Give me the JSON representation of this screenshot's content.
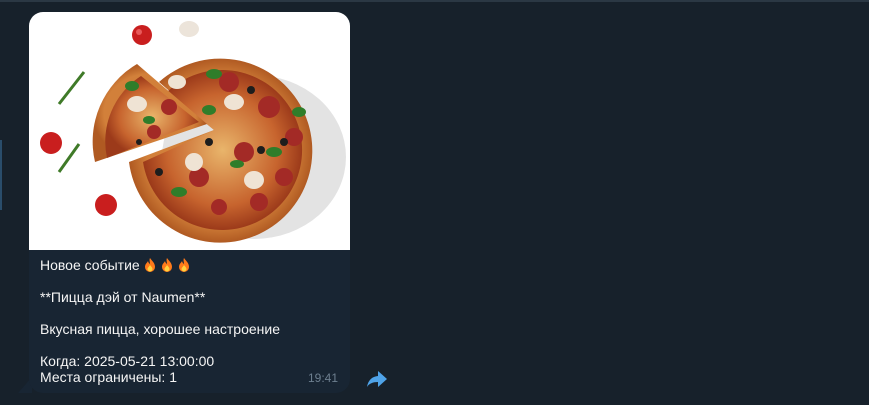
{
  "message": {
    "title": "Новое событие",
    "emoji": [
      "fire-icon",
      "fire-icon",
      "fire-icon"
    ],
    "event_name": "**Пицца дэй от Naumen**",
    "description": "Вкусная пицца, хорошее настроение",
    "when": "Когда: 2025-05-21 13:00:00",
    "places": "Места ограничены: 1",
    "time": "19:41"
  },
  "icons": {
    "forward": "forward-arrow-icon"
  },
  "colors": {
    "background": "#17212b",
    "bubble": "#182533",
    "text": "#f5f5f5",
    "time": "#6d7f8f",
    "accent": "#4fa3e8"
  }
}
